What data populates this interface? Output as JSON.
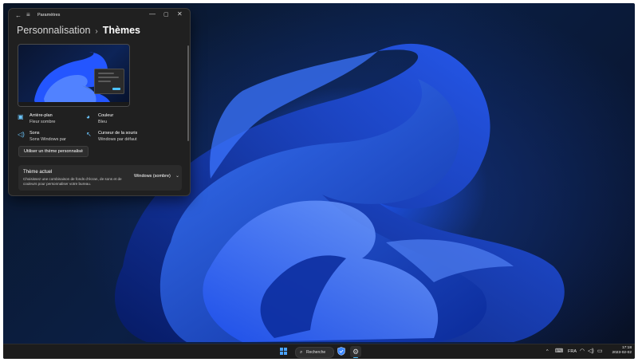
{
  "window": {
    "title": "Paramètres",
    "breadcrumb_parent": "Personnalisation",
    "breadcrumb_separator": "›",
    "breadcrumb_current": "Thèmes",
    "controls": {
      "minimize": "—",
      "maximize": "▢",
      "close": "✕"
    }
  },
  "theme_options": [
    {
      "icon": "picture-icon",
      "title": "Arrière-plan",
      "value": "Fleur sombre"
    },
    {
      "icon": "palette-icon",
      "title": "Couleur",
      "value": "Bleu"
    },
    {
      "icon": "speaker-icon",
      "title": "Sons",
      "value": "Sons Windows par"
    },
    {
      "icon": "cursor-icon",
      "title": "Curseur de la souris",
      "value": "Windows par défaut"
    }
  ],
  "custom_theme_button": "Utiliser un thème personnalisé",
  "current_theme": {
    "heading": "Thème actuel",
    "description": "Choisissez une combinaison de fonds d’écran, de sons et de couleurs pour personnaliser votre bureau.",
    "selected": "Windows (sombre)"
  },
  "taskbar": {
    "search_label": "Recherche",
    "tray": {
      "language": "FRA",
      "time": "17:18",
      "date": "2023-02-02"
    }
  },
  "colors": {
    "accent": "#4cc2ff",
    "window_bg": "#202020",
    "taskbar_bg": "#1c1c1c",
    "wallpaper_blue": "#1f58ff"
  }
}
